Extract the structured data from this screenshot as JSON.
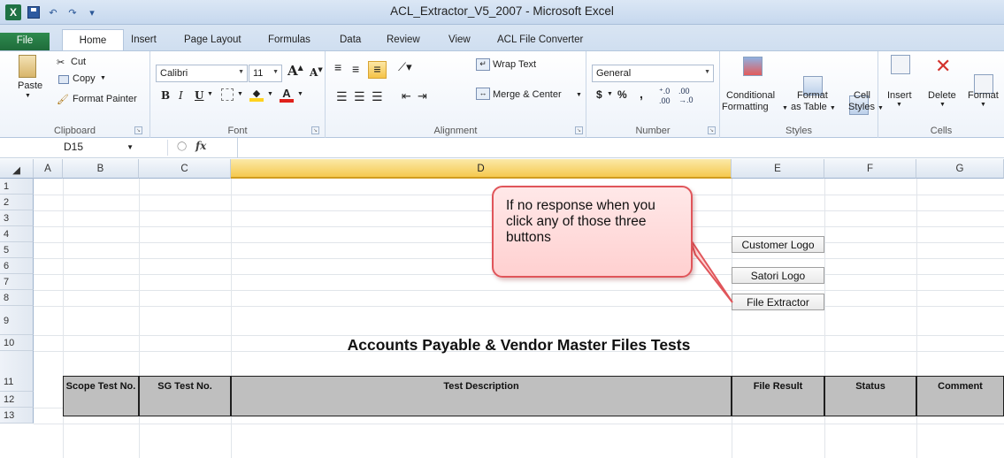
{
  "window": {
    "title": "ACL_Extractor_V5_2007 - Microsoft Excel"
  },
  "menu_tabs": [
    "File",
    "Home",
    "Insert",
    "Page Layout",
    "Formulas",
    "Data",
    "Review",
    "View",
    "ACL File Converter"
  ],
  "ribbon": {
    "clipboard": {
      "paste": "Paste",
      "cut": "Cut",
      "copy": "Copy",
      "format_painter": "Format Painter",
      "label": "Clipboard"
    },
    "font": {
      "name": "Calibri",
      "size": "11",
      "label": "Font"
    },
    "alignment": {
      "wrap_text": "Wrap Text",
      "merge_center": "Merge & Center",
      "label": "Alignment"
    },
    "number": {
      "format": "General",
      "currency": "$",
      "percent": "%",
      "comma": ",",
      "label": "Number"
    },
    "styles": {
      "conditional": "Conditional",
      "conditional2": "Formatting",
      "format_as": "Format",
      "format_as2": "as Table",
      "cell": "Cell",
      "cell2": "Styles",
      "label": "Styles"
    },
    "cells": {
      "insert": "Insert",
      "delete": "Delete",
      "format": "Format",
      "label": "Cells"
    }
  },
  "formula_bar": {
    "name_box": "D15",
    "fx": "fx",
    "value": ""
  },
  "columns": [
    "A",
    "B",
    "C",
    "D",
    "E",
    "F",
    "G"
  ],
  "rows": [
    "1",
    "2",
    "3",
    "4",
    "5",
    "6",
    "7",
    "8",
    "9",
    "10",
    "11",
    "12",
    "13"
  ],
  "sheet_buttons": {
    "customer_logo": "Customer Logo",
    "satori_logo": "Satori Logo",
    "file_extractor": "File Extractor"
  },
  "callout": {
    "text": "If no response when you click any of those three buttons"
  },
  "heading": "Accounts Payable & Vendor Master Files Tests",
  "table_headers": [
    "Scope Test No.",
    "SG Test No.",
    "Test Description",
    "File Result",
    "Status",
    "Comment"
  ]
}
